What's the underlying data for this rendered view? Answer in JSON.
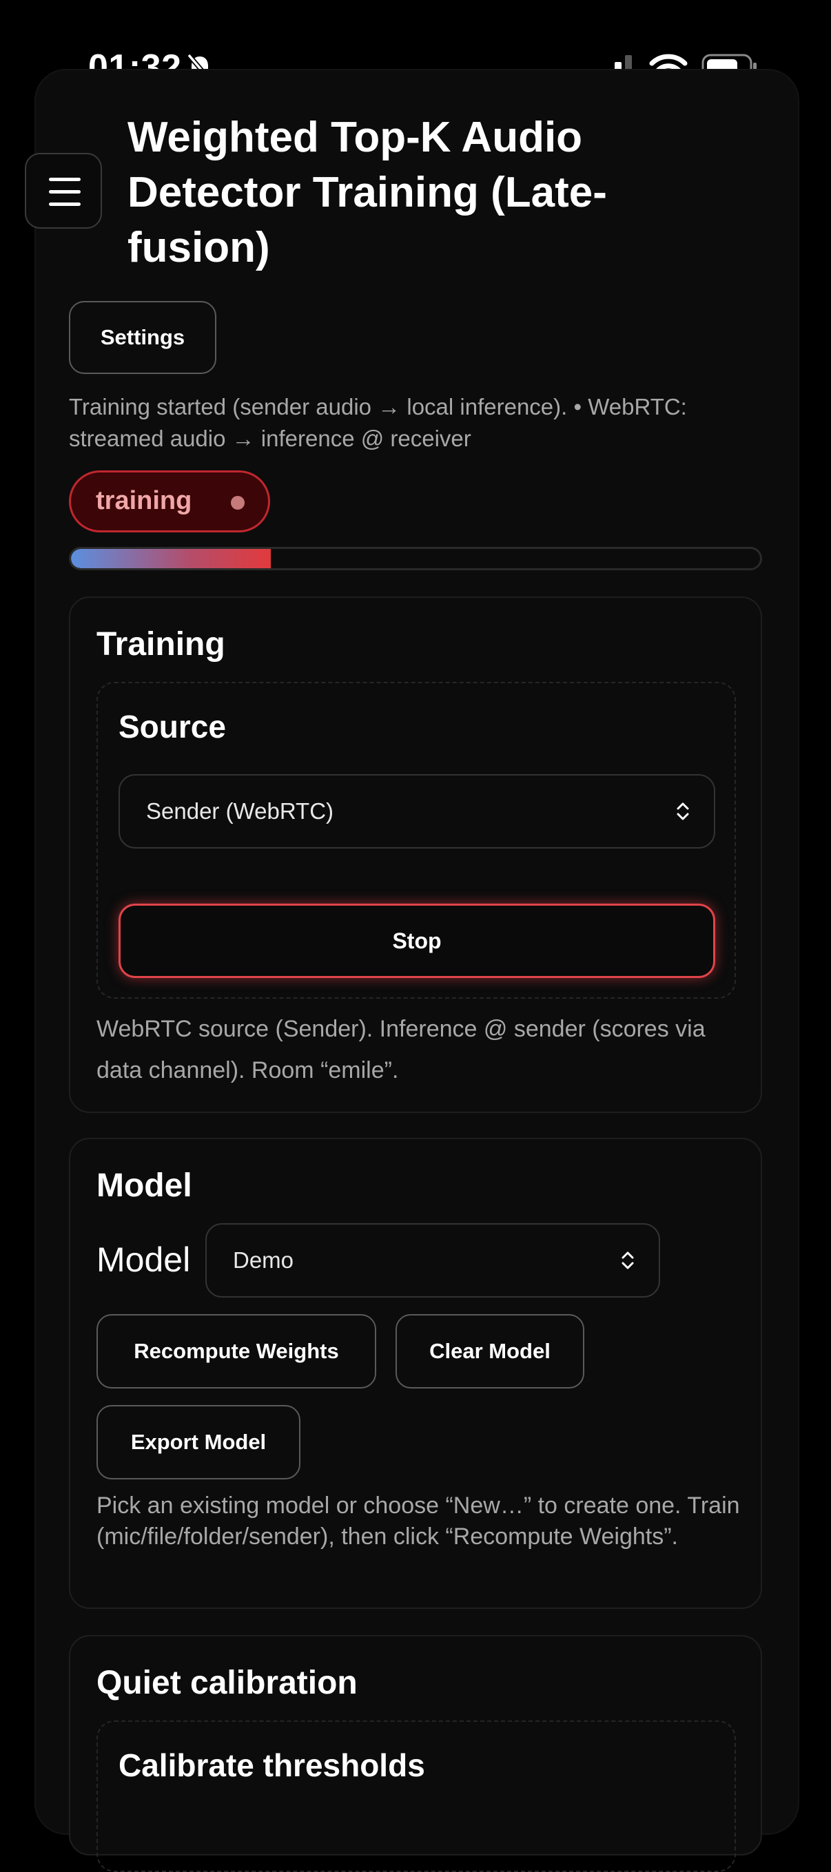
{
  "status_bar": {
    "time": "01:32",
    "icons": [
      "bell-slash-icon",
      "signal-icon",
      "wifi-icon",
      "battery-icon"
    ]
  },
  "header": {
    "menu_icon": "hamburger-menu-icon",
    "title": "Weighted Top-K Audio Detector Training (Late-fusion)"
  },
  "settings_button": "Settings",
  "status_text": "Training started (sender audio → local inference). • WebRTC: streamed audio → inference @ receiver",
  "status_pill": {
    "label": "training",
    "color": "#c0272f"
  },
  "progress": {
    "fraction": 0.29,
    "colors": [
      "#5b8fe0",
      "#e23a3c"
    ]
  },
  "training_card": {
    "title": "Training",
    "source_section": {
      "title": "Source",
      "select_value": "Sender (WebRTC)",
      "stop_label": "Stop"
    },
    "help": "WebRTC source (Sender). Inference @ sender (scores via data channel). Room “emile”."
  },
  "model_card": {
    "title": "Model",
    "model_label": "Model",
    "model_select_value": "Demo",
    "recompute_label": "Recompute Weights",
    "clear_label": "Clear Model",
    "export_label": "Export Model",
    "help": "Pick an existing model or choose “New…” to create one. Train (mic/file/folder/sender), then click “Recompute Weights”."
  },
  "quiet_card": {
    "title": "Quiet calibration",
    "section_title": "Calibrate thresholds"
  }
}
